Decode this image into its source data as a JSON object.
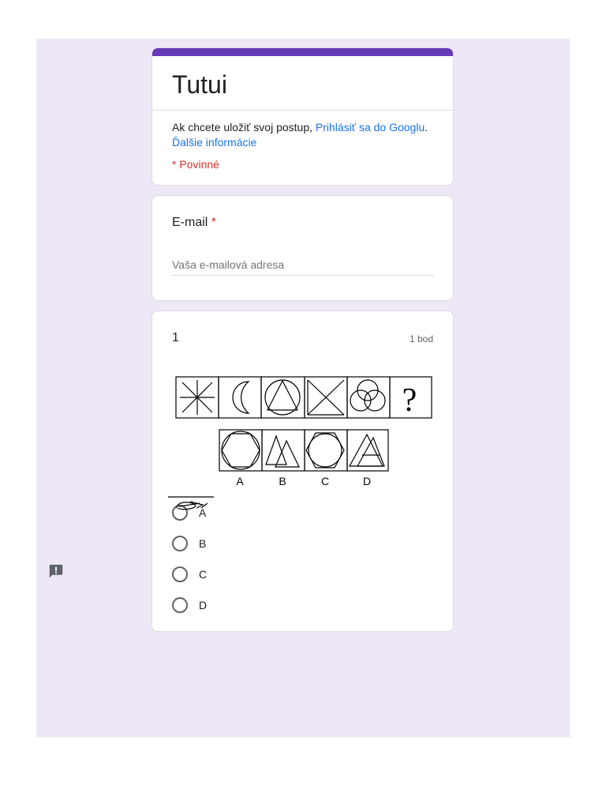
{
  "form": {
    "title": "Tutui",
    "signin_prefix": "Ak chcete uložiť svoj postup, ",
    "signin_link": "Prihlásiť sa do Googlu",
    "signin_sep": ". ",
    "more_info": "Ďalšie informácie",
    "required_note": "* Povinné"
  },
  "email": {
    "label": "E-mail",
    "required_mark": "*",
    "placeholder": "Vaša e-mailová adresa",
    "value": ""
  },
  "question": {
    "number": "1",
    "points": "1 bod",
    "figure_labels": [
      "A",
      "B",
      "C",
      "D"
    ],
    "question_mark": "?",
    "options": [
      "A",
      "B",
      "C",
      "D"
    ]
  },
  "colors": {
    "accent": "#673ab7",
    "background": "#ede7f6",
    "link": "#1a73e8",
    "required": "#d93025"
  },
  "icons": {
    "report": "report-problem-icon"
  }
}
